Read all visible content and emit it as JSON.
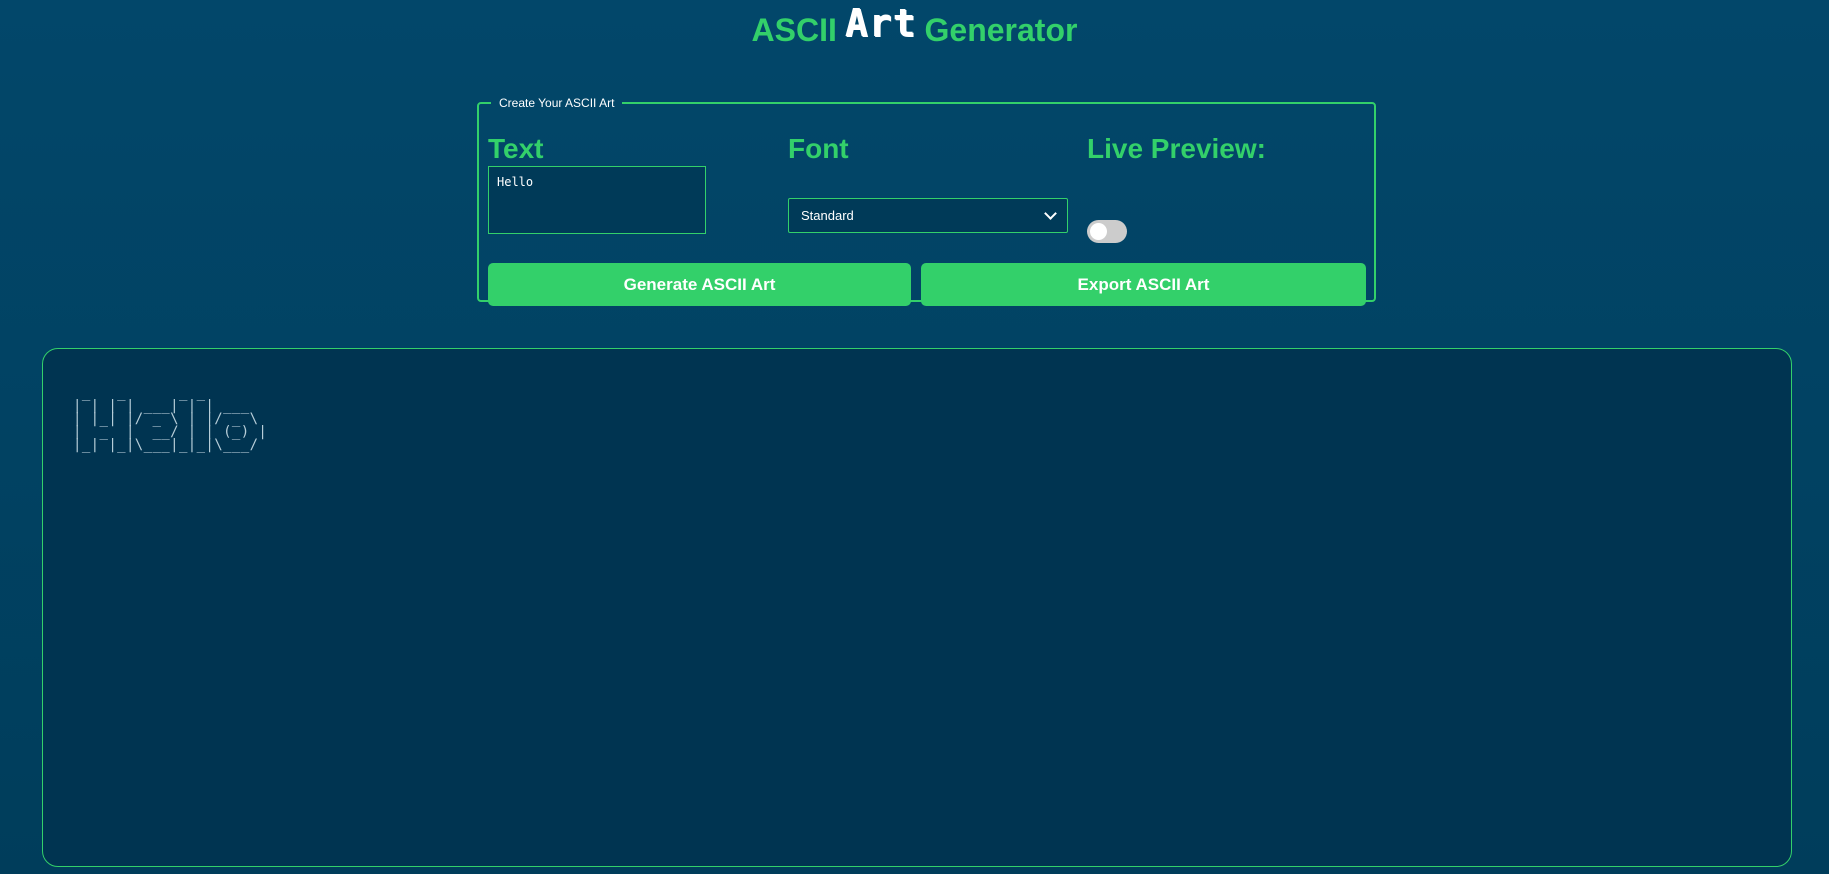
{
  "header": {
    "title_left": "ASCII",
    "title_art": "Art",
    "title_right": "Generator"
  },
  "form": {
    "legend": "Create Your ASCII Art",
    "text_heading": "Text",
    "text_value": "Hello",
    "font_heading": "Font",
    "font_selected": "Standard",
    "preview_heading": "Live Preview:",
    "live_preview_on": false,
    "generate_label": "Generate ASCII Art",
    "export_label": "Export ASCII Art"
  },
  "output": {
    "ascii_art": " _   _      _ _       \n| | | | ___| | | ___  \n| |_| |/ _ \\ | |/ _ \\ \n|  _  |  __/ | | (_) |\n|_| |_|\\___|_|_|\\___/ "
  },
  "colors": {
    "accent": "#33d06a",
    "background": "#02476a",
    "panel": "#003451"
  },
  "icons": {
    "select_arrow": "chevron-down-icon"
  }
}
